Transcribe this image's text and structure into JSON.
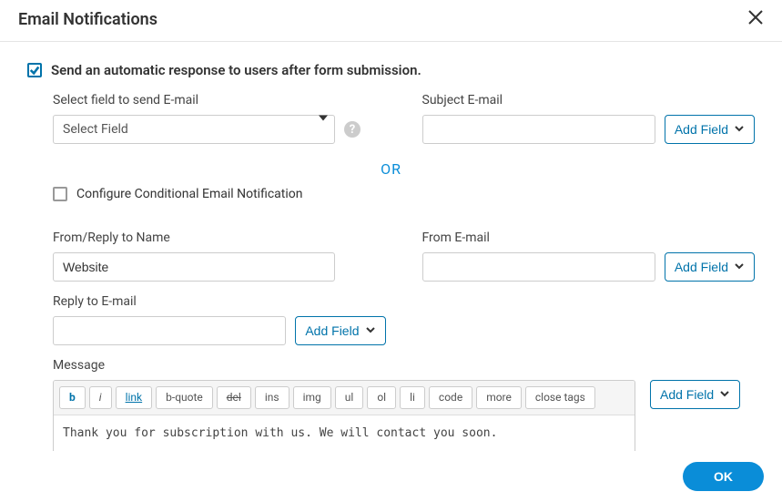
{
  "dialog": {
    "title": "Email Notifications",
    "ok_label": "OK"
  },
  "auto_response": {
    "checkbox_label": "Send an automatic response to users after form submission.",
    "checked": true
  },
  "select_field": {
    "label": "Select field to send E-mail",
    "value": "Select Field"
  },
  "subject": {
    "label": "Subject E-mail",
    "value": "",
    "add_field_label": "Add Field"
  },
  "or_text": "OR",
  "conditional": {
    "label": "Configure Conditional Email Notification",
    "checked": false
  },
  "from_name": {
    "label": "From/Reply to Name",
    "value": "Website"
  },
  "from_email": {
    "label": "From E-mail",
    "value": "",
    "add_field_label": "Add Field"
  },
  "reply_to": {
    "label": "Reply to E-mail",
    "value": "",
    "add_field_label": "Add Field"
  },
  "message": {
    "label": "Message",
    "add_field_label": "Add Field",
    "toolbar": {
      "b": "b",
      "i": "i",
      "link": "link",
      "bquote": "b-quote",
      "del": "del",
      "ins": "ins",
      "img": "img",
      "ul": "ul",
      "ol": "ol",
      "li": "li",
      "code": "code",
      "more": "more",
      "close_tags": "close tags"
    },
    "content": "Thank you for subscription with us. We will contact you soon."
  }
}
